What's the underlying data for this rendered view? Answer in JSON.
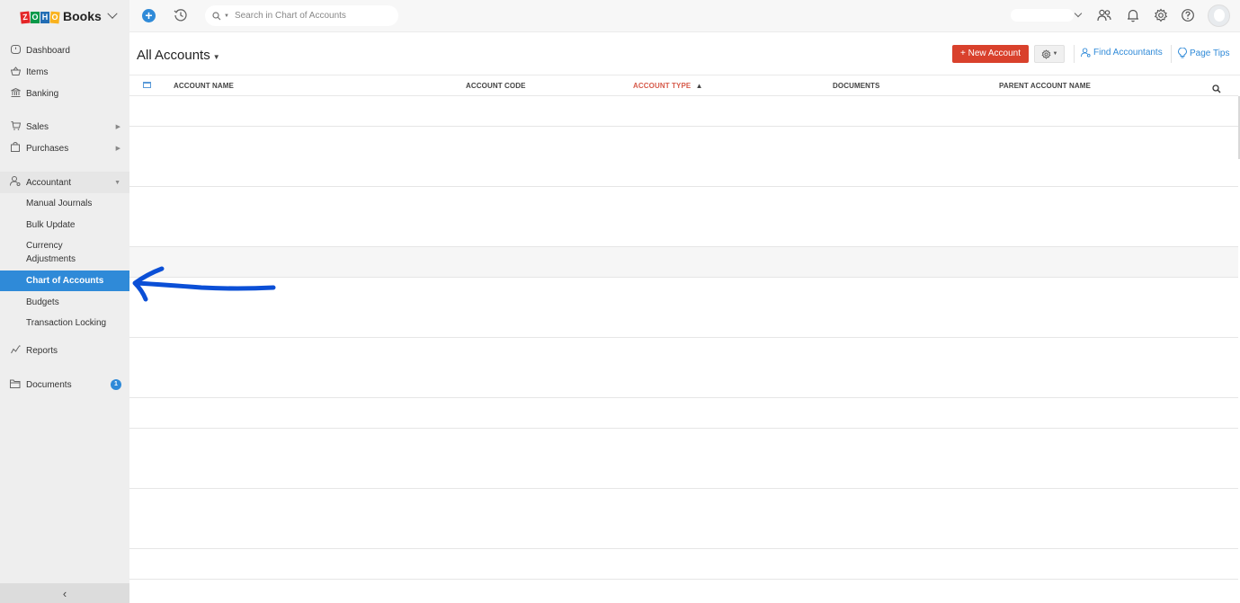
{
  "brand": {
    "name": "Books",
    "logo_letters": [
      "Z",
      "O",
      "H",
      "O"
    ]
  },
  "topbar": {
    "search_placeholder": "Search in Chart of Accounts",
    "icons": [
      "plus-circle-icon",
      "history-icon",
      "search-icon",
      "refer-users-icon",
      "bell-icon",
      "gear-icon",
      "help-icon",
      "avatar"
    ]
  },
  "sidebar": {
    "items": [
      {
        "label": "Dashboard",
        "icon": "dashboard-icon"
      },
      {
        "label": "Items",
        "icon": "basket-icon"
      },
      {
        "label": "Banking",
        "icon": "bank-icon"
      },
      {
        "label": "Sales",
        "icon": "cart-icon"
      },
      {
        "label": "Purchases",
        "icon": "bag-icon"
      },
      {
        "label": "Accountant",
        "icon": "accountant-icon"
      },
      {
        "label": "Reports",
        "icon": "reports-icon"
      },
      {
        "label": "Documents",
        "icon": "folder-icon",
        "badge": "1"
      }
    ],
    "accountant_sub": [
      {
        "label": "Manual Journals"
      },
      {
        "label": "Bulk Update"
      },
      {
        "label": "Currency Adjustments"
      },
      {
        "label": "Chart of Accounts",
        "active": true
      },
      {
        "label": "Budgets"
      },
      {
        "label": "Transaction Locking"
      }
    ],
    "collapse_label": "‹"
  },
  "header": {
    "title": "All Accounts",
    "new_account_label": "+ New Account",
    "find_accountants_label": "Find Accountants",
    "page_tips_label": "Page Tips"
  },
  "table": {
    "columns": [
      {
        "label": "ACCOUNT NAME"
      },
      {
        "label": "ACCOUNT CODE"
      },
      {
        "label": "ACCOUNT TYPE",
        "sorted": "ascending"
      },
      {
        "label": "DOCUMENTS"
      },
      {
        "label": "PARENT ACCOUNT NAME"
      }
    ],
    "row_count_visible": 17,
    "rows_content": "redacted"
  },
  "colors": {
    "accent": "#2f8ad8",
    "new_button": "#d9412c",
    "sorted_header": "#d65a4a",
    "annotation_arrow": "#0b4fd6"
  }
}
